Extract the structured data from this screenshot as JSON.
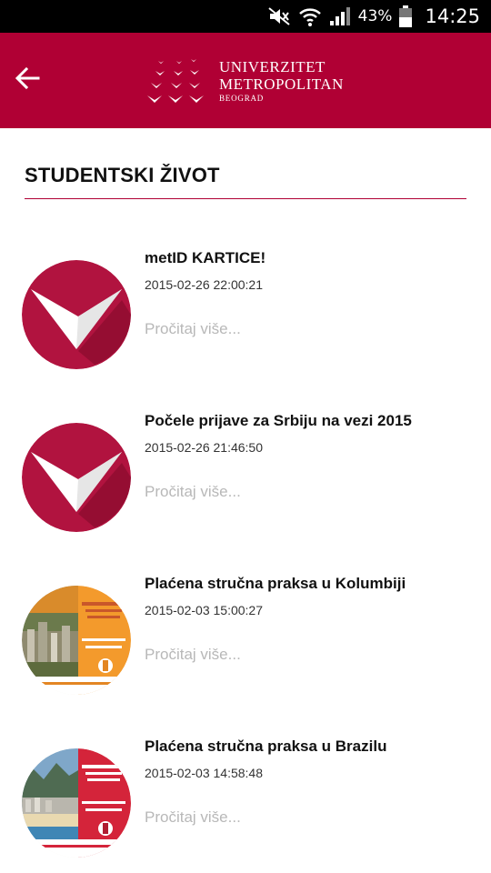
{
  "status_bar": {
    "battery_percent": "43%",
    "time": "14:25",
    "icons": [
      "mute-icon",
      "wifi-icon",
      "signal-icon",
      "battery-icon"
    ]
  },
  "app_bar": {
    "back_icon": "arrow-left-icon",
    "logo": {
      "line1": "UNIVERZITET",
      "line2": "METROPOLITAN",
      "line3": "BEOGRAD"
    },
    "color": "#b00034"
  },
  "page": {
    "title": "STUDENTSKI ŽIVOT"
  },
  "news": [
    {
      "title": "metID KARTICE!",
      "date": "2015-02-26 22:00:21",
      "more": "Pročitaj više...",
      "thumb": "logo"
    },
    {
      "title": "Počele prijave za Srbiju na vezi 2015",
      "date": "2015-02-26 21:46:50",
      "more": "Pročitaj više...",
      "thumb": "logo"
    },
    {
      "title": "Plaćena stručna praksa u Kolumbiji",
      "date": "2015-02-03 15:00:27",
      "more": "Pročitaj više...",
      "thumb": "poster-colombia"
    },
    {
      "title": "Plaćena stručna praksa u Brazilu",
      "date": "2015-02-03 14:58:48",
      "more": "Pročitaj više...",
      "thumb": "poster-brazil"
    }
  ]
}
